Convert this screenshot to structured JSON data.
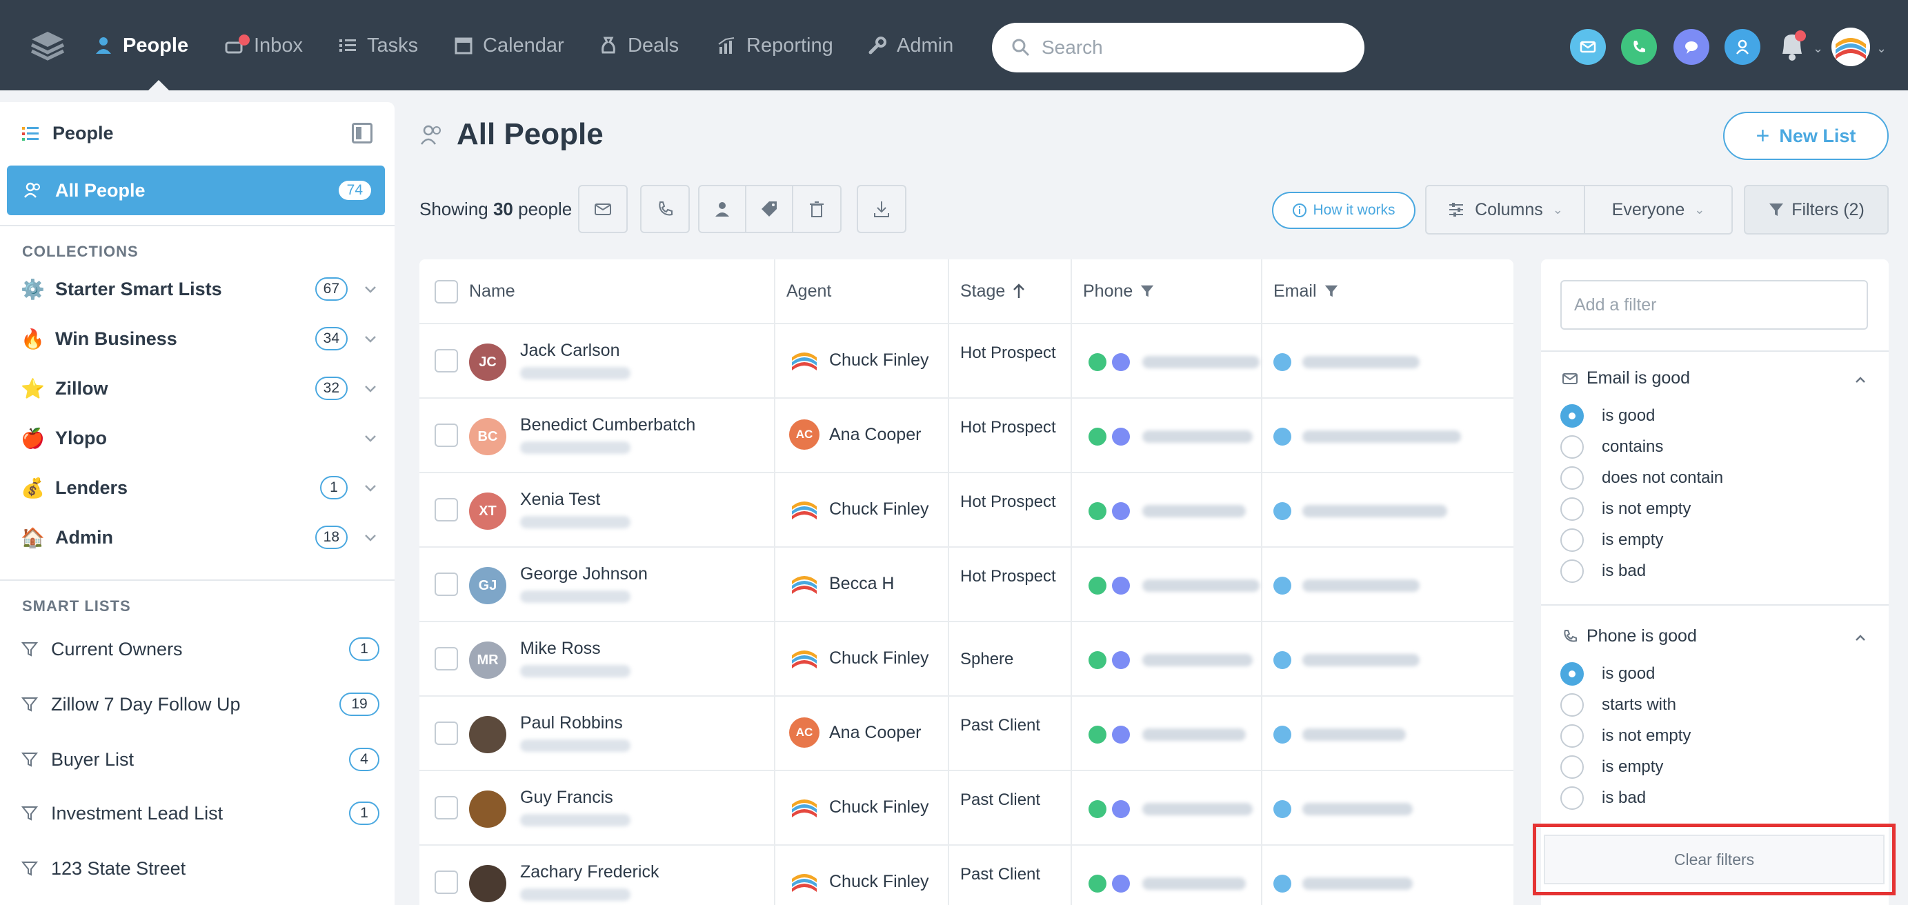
{
  "nav": {
    "items": [
      {
        "label": "People",
        "icon": "person-icon"
      },
      {
        "label": "Inbox",
        "icon": "inbox-icon"
      },
      {
        "label": "Tasks",
        "icon": "list-icon"
      },
      {
        "label": "Calendar",
        "icon": "calendar-icon"
      },
      {
        "label": "Deals",
        "icon": "money-bag-icon"
      },
      {
        "label": "Reporting",
        "icon": "chart-icon"
      },
      {
        "label": "Admin",
        "icon": "wrench-icon"
      }
    ],
    "search_placeholder": "Search",
    "colors": {
      "bg": "#34404d",
      "mail": "#5bc0ec",
      "phone": "#3fc47f",
      "chat": "#7c8cf5",
      "person": "#44a6e6"
    }
  },
  "sidebar": {
    "header": "People",
    "active": {
      "label": "All People",
      "count": "74"
    },
    "collections_title": "COLLECTIONS",
    "collections": [
      {
        "label": "Starter Smart Lists",
        "emoji": "⚙️",
        "count": "67"
      },
      {
        "label": "Win Business",
        "emoji": "🔥",
        "count": "34"
      },
      {
        "label": "Zillow",
        "emoji": "⭐",
        "count": "32"
      },
      {
        "label": "Ylopo",
        "emoji": "🍎",
        "count": ""
      },
      {
        "label": "Lenders",
        "emoji": "💰",
        "count": "1"
      },
      {
        "label": "Admin",
        "emoji": "🏠",
        "count": "18"
      }
    ],
    "smart_lists_title": "SMART LISTS",
    "smart_lists": [
      {
        "label": "Current Owners",
        "count": "1"
      },
      {
        "label": "Zillow 7 Day Follow Up",
        "count": "19"
      },
      {
        "label": "Buyer List",
        "count": "4"
      },
      {
        "label": "Investment Lead List",
        "count": "1"
      },
      {
        "label": "123 State Street",
        "count": ""
      }
    ]
  },
  "main": {
    "title": "All People",
    "new_list": "New List",
    "showing_prefix": "Showing",
    "showing_count": "30",
    "showing_suffix": "people",
    "how_it_works": "How it works",
    "columns": "Columns",
    "everyone": "Everyone",
    "filters": "Filters (2)"
  },
  "table": {
    "headers": {
      "name": "Name",
      "agent": "Agent",
      "stage": "Stage",
      "phone": "Phone",
      "email": "Email"
    },
    "rows": [
      {
        "initials": "JC",
        "name": "Jack Carlson",
        "avatar_color": "#a85a5a",
        "agent": "Chuck Finley",
        "agent_type": "logo",
        "stage": "Hot Prospect"
      },
      {
        "initials": "BC",
        "name": "Benedict Cumberbatch",
        "avatar_color": "#f0a58c",
        "agent": "Ana Cooper",
        "agent_type": "ac",
        "stage": "Hot Prospect"
      },
      {
        "initials": "XT",
        "name": "Xenia Test",
        "avatar_color": "#d9736a",
        "agent": "Chuck Finley",
        "agent_type": "logo",
        "stage": "Hot Prospect"
      },
      {
        "initials": "GJ",
        "name": "George Johnson",
        "avatar_color": "#7ea6c8",
        "agent": "Becca H",
        "agent_type": "logo",
        "stage": "Hot Prospect"
      },
      {
        "initials": "MR",
        "name": "Mike Ross",
        "avatar_color": "#a0a8b6",
        "agent": "Chuck Finley",
        "agent_type": "logo",
        "stage": "Sphere"
      },
      {
        "initials": "",
        "name": "Paul Robbins",
        "avatar_color": "#5c4a3c",
        "agent": "Ana Cooper",
        "agent_type": "ac",
        "stage": "Past Client"
      },
      {
        "initials": "",
        "name": "Guy Francis",
        "avatar_color": "#8a5a2a",
        "agent": "Chuck Finley",
        "agent_type": "logo",
        "stage": "Past Client"
      },
      {
        "initials": "",
        "name": "Zachary Frederick",
        "avatar_color": "#4a3a30",
        "agent": "Chuck Finley",
        "agent_type": "logo",
        "stage": "Past Client"
      }
    ]
  },
  "filters": {
    "add_placeholder": "Add a filter",
    "email_section": "Email is good",
    "email_options": [
      "is good",
      "contains",
      "does not contain",
      "is not empty",
      "is empty",
      "is bad"
    ],
    "email_selected": 0,
    "phone_section": "Phone is good",
    "phone_options": [
      "is good",
      "starts with",
      "is not empty",
      "is empty",
      "is bad"
    ],
    "phone_selected": 0,
    "clear": "Clear filters"
  }
}
